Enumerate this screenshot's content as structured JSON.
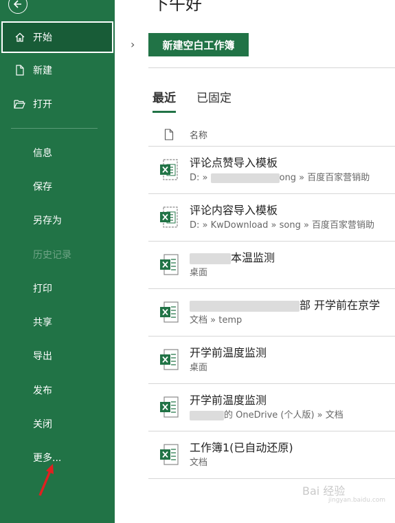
{
  "sidebar": {
    "top_items": [
      {
        "label": "开始",
        "icon": "home-icon"
      },
      {
        "label": "新建",
        "icon": "new-file-icon"
      },
      {
        "label": "打开",
        "icon": "open-folder-icon"
      }
    ],
    "items": [
      {
        "label": "信息"
      },
      {
        "label": "保存"
      },
      {
        "label": "另存为"
      },
      {
        "label": "历史记录"
      },
      {
        "label": "打印"
      },
      {
        "label": "共享"
      },
      {
        "label": "导出"
      },
      {
        "label": "发布"
      },
      {
        "label": "关闭"
      },
      {
        "label": "更多..."
      }
    ]
  },
  "main": {
    "greeting": "下午好",
    "new_blank_label": "新建空白工作簿",
    "tabs": [
      {
        "label": "最近"
      },
      {
        "label": "已固定"
      }
    ],
    "list_header": "名称",
    "files": [
      {
        "name": "评论点赞导入模板",
        "path_prefix": "D: » ",
        "path": "ong » 百度百家营销助"
      },
      {
        "name": "评论内容导入模板",
        "path_prefix": "",
        "path": "D: » KwDownload » song » 百度百家营销助"
      },
      {
        "name": "本温监测",
        "path_prefix": "",
        "path": "桌面"
      },
      {
        "name": "部 开学前在京学",
        "path_prefix": "",
        "path": "文档 » temp"
      },
      {
        "name": "开学前温度监测",
        "path_prefix": "",
        "path": "桌面"
      },
      {
        "name": "开学前温度监测",
        "path_prefix": "",
        "path": "的 OneDrive (个人版) » 文档"
      },
      {
        "name": "工作簿1(已自动还原)",
        "path_prefix": "",
        "path": "文档"
      }
    ]
  },
  "watermark": {
    "text": "Bai 经验",
    "sub": "jingyan.baidu.com"
  },
  "colors": {
    "accent": "#217346",
    "active_bg": "#185c37",
    "annotation_arrow": "#e02020"
  }
}
